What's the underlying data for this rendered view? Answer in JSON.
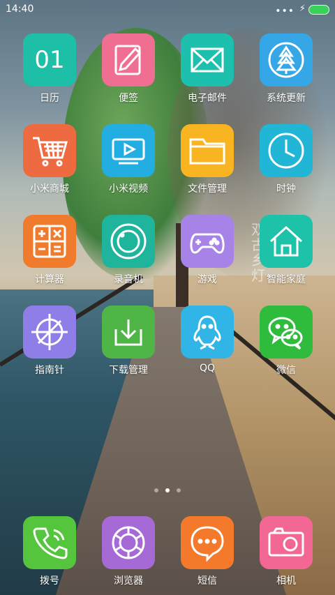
{
  "status_bar": {
    "time": "14:40",
    "signal": "•••",
    "charging_icon": "bolt-icon",
    "battery_color": "#3ad15a"
  },
  "wallpaper": {
    "calligraphy": "双古乡灯"
  },
  "grid": [
    {
      "label": "日历",
      "icon": "calendar-icon",
      "color": "#1dbfa6",
      "text": "01"
    },
    {
      "label": "便签",
      "icon": "note-icon",
      "color": "#f06e91"
    },
    {
      "label": "电子邮件",
      "icon": "mail-icon",
      "color": "#1cc0ad"
    },
    {
      "label": "系统更新",
      "icon": "update-icon",
      "color": "#35a6e6"
    },
    {
      "label": "小米商城",
      "icon": "cart-icon",
      "color": "#ee6a41"
    },
    {
      "label": "小米视频",
      "icon": "video-icon",
      "color": "#23aee1"
    },
    {
      "label": "文件管理",
      "icon": "folder-icon",
      "color": "#f8b521"
    },
    {
      "label": "时钟",
      "icon": "clock-icon",
      "color": "#21b6d6"
    },
    {
      "label": "计算器",
      "icon": "calculator-icon",
      "color": "#f07b2d"
    },
    {
      "label": "录音机",
      "icon": "recorder-icon",
      "color": "#1fb49c"
    },
    {
      "label": "游戏",
      "icon": "gamepad-icon",
      "color": "#a783e8"
    },
    {
      "label": "智能家庭",
      "icon": "home-icon",
      "color": "#1ec2a8"
    },
    {
      "label": "指南针",
      "icon": "compass-icon",
      "color": "#8f7ee8"
    },
    {
      "label": "下载管理",
      "icon": "download-icon",
      "color": "#4fb547"
    },
    {
      "label": "QQ",
      "icon": "qq-icon",
      "color": "#31b4e6"
    },
    {
      "label": "微信",
      "icon": "wechat-icon",
      "color": "#2fbb3c"
    }
  ],
  "page_indicator": {
    "count": 3,
    "active": 1
  },
  "dock": [
    {
      "label": "拨号",
      "icon": "phone-icon",
      "color": "#54c53d"
    },
    {
      "label": "浏览器",
      "icon": "browser-icon",
      "color": "#a66ad6"
    },
    {
      "label": "短信",
      "icon": "message-icon",
      "color": "#f5792a"
    },
    {
      "label": "相机",
      "icon": "camera-icon",
      "color": "#f26793"
    }
  ]
}
